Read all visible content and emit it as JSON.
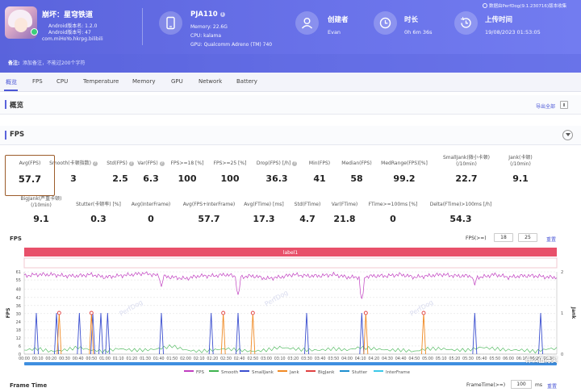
{
  "app": {
    "name": "崩坏：星穹铁道",
    "version": "Android版本名: 1.2.0",
    "build": "Android版本号: 47",
    "package": "com.miHoYo.hkrpg.bilibili"
  },
  "device": {
    "name": "PJA110",
    "memory": "Memory: 22.6G",
    "cpu": "CPU: kalama",
    "gpu": "GPU: Qualcomm Adreno (TM) 740"
  },
  "creator": {
    "label": "创建者",
    "value": "Evan"
  },
  "duration": {
    "label": "时长",
    "value": "0h 6m 36s"
  },
  "upload": {
    "label": "上传时间",
    "value": "19/08/2023 01:53:05"
  },
  "source_note": "数据由PerfDog(9.1.230716)版本收集",
  "remark": {
    "label": "备注:",
    "placeholder": "添加备注，不能过200个字符"
  },
  "tabs": [
    "概览",
    "FPS",
    "CPU",
    "Temperature",
    "Memory",
    "GPU",
    "Network",
    "Battery"
  ],
  "overview": {
    "title": "概览",
    "export_label": "导出全部"
  },
  "fps_section": {
    "title": "FPS"
  },
  "stats_row1": [
    {
      "label": "Avg(FPS)",
      "value": "57.7"
    },
    {
      "label": "Smooth(卡顿指数)",
      "value": "3"
    },
    {
      "label": "Std(FPS)",
      "value": "2.5"
    },
    {
      "label": "Var(FPS)",
      "value": "6.3"
    },
    {
      "label": "FPS>=18 [%]",
      "value": "100"
    },
    {
      "label": "FPS>=25 [%]",
      "value": "100"
    },
    {
      "label": "Drop(FPS) [/h]",
      "value": "36.3"
    },
    {
      "label": "Min(FPS)",
      "value": "41"
    },
    {
      "label": "Median(FPS)",
      "value": "58"
    },
    {
      "label": "MedRange(FPS)[%]",
      "value": "99.2"
    },
    {
      "label": "SmallJank(微小卡顿)",
      "label2": "(/10min)",
      "value": "22.7"
    },
    {
      "label": "Jank(卡顿)",
      "label2": "(/10min)",
      "value": "9.1"
    }
  ],
  "stats_row2": [
    {
      "label": "BigJank(严重卡顿)",
      "label2": "(/10min)",
      "value": "9.1"
    },
    {
      "label": "Stutter(卡顿率) [%]",
      "value": "0.3"
    },
    {
      "label": "Avg(InterFrame)",
      "value": "0"
    },
    {
      "label": "Avg(FPS+InterFrame)",
      "value": "57.7"
    },
    {
      "label": "Avg(FTime) [ms]",
      "value": "17.3"
    },
    {
      "label": "Std(FTime)",
      "value": "4.7"
    },
    {
      "label": "Var(FTime)",
      "value": "21.8"
    },
    {
      "label": "FTime>=100ms [%]",
      "value": "0"
    },
    {
      "label": "Delta(FTime)>100ms [/h]",
      "value": "54.3"
    }
  ],
  "chart_controls": {
    "fps_label": "FPS(>=)",
    "fps_min1": "18",
    "fps_min2": "25",
    "reset": "重置"
  },
  "frametime": {
    "title": "Frame Time",
    "label": "FrameTime(>=)",
    "value": "100",
    "unit": "ms",
    "reset": "重置"
  },
  "watermark": "什么值得买",
  "colors": {
    "fps": "#c03fc0",
    "smooth": "#3fb34f",
    "smalljank": "#3b4fcf",
    "jank": "#f08a24",
    "bigjank": "#e04141",
    "stutter": "#1e8fcf",
    "interframe": "#3cc8e8",
    "label_band": "#e8506a"
  },
  "chart_data": {
    "type": "line",
    "title": "FPS",
    "band_label": "label1",
    "ylabel": "FPS",
    "y2label": "Jank",
    "ylim": [
      0,
      61
    ],
    "y2lim": [
      0,
      2
    ],
    "yticks": [
      0,
      6,
      12,
      18,
      24,
      30,
      36,
      42,
      48,
      55,
      61
    ],
    "y2ticks": [
      0,
      1,
      2
    ],
    "x": [
      "00:00",
      "00:10",
      "00:20",
      "00:30",
      "00:40",
      "00:50",
      "01:00",
      "01:10",
      "01:20",
      "01:30",
      "01:40",
      "01:50",
      "02:00",
      "02:10",
      "02:20",
      "02:30",
      "02:40",
      "02:50",
      "03:00",
      "03:10",
      "03:20",
      "03:30",
      "03:40",
      "03:50",
      "04:00",
      "04:10",
      "04:20",
      "04:30",
      "04:40",
      "04:50",
      "05:00",
      "05:10",
      "05:20",
      "05:30",
      "05:40",
      "05:50",
      "06:00",
      "06:10",
      "06:20",
      "06:30"
    ],
    "x_seconds_max": 396,
    "series": [
      {
        "name": "FPS",
        "type": "line",
        "values": [
          58,
          59,
          59,
          58,
          58,
          59,
          57,
          58,
          59,
          60,
          58,
          57,
          56,
          58,
          58,
          59,
          57,
          58,
          56,
          57,
          59,
          58,
          58,
          59,
          57,
          57,
          58,
          58,
          59,
          57,
          58,
          59,
          58,
          58,
          57,
          59,
          57,
          58,
          58,
          57
        ]
      },
      {
        "name": "Smooth",
        "type": "line",
        "values": [
          3,
          4,
          2,
          3,
          5,
          3,
          2,
          4,
          3,
          3,
          4,
          6,
          3,
          2,
          3,
          4,
          3,
          2,
          3,
          5,
          4,
          3,
          3,
          4,
          3,
          5,
          4,
          3,
          3,
          2,
          4,
          4,
          3,
          3,
          5,
          4,
          3,
          3,
          2,
          4
        ]
      },
      {
        "name": "SmallJank",
        "events_seconds": [
          9,
          24,
          41,
          51,
          57,
          62,
          102,
          139,
          159,
          210,
          251,
          335,
          384
        ]
      },
      {
        "name": "Jank",
        "events_seconds": [
          26,
          50,
          148,
          170,
          254,
          297
        ]
      },
      {
        "name": "BigJank",
        "events_seconds": [
          26,
          50,
          148,
          170,
          254,
          297
        ]
      },
      {
        "name": "Stutter",
        "values": []
      },
      {
        "name": "InterFrame",
        "values": []
      }
    ],
    "fps_dips": [
      {
        "t": 102,
        "v": 50
      },
      {
        "t": 159,
        "v": 44
      },
      {
        "t": 251,
        "v": 41
      },
      {
        "t": 335,
        "v": 51
      }
    ],
    "legend": [
      "FPS",
      "Smooth",
      "SmallJank",
      "Jank",
      "BigJank",
      "Stutter",
      "InterFrame"
    ],
    "legend_position": "bottom",
    "grid": true
  }
}
